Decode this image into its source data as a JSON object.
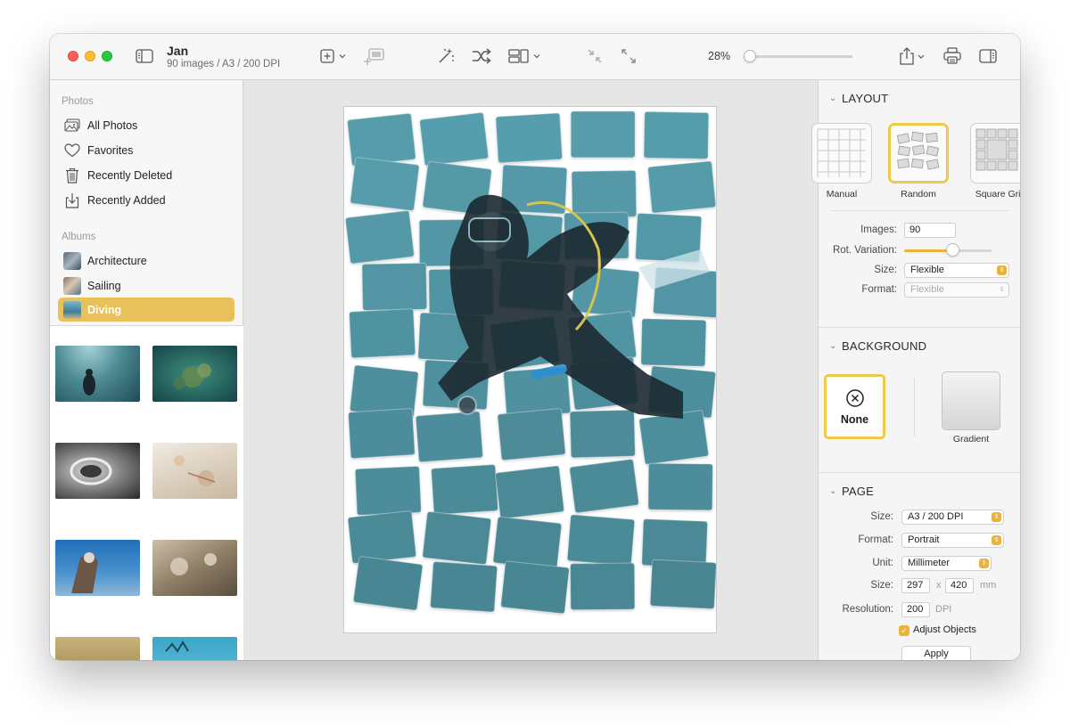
{
  "toolbar": {
    "title": "Jan",
    "subtitle": "90 images / A3 / 200 DPI",
    "zoom": "28%",
    "zoom_level": 0.0
  },
  "sidebar": {
    "photos_header": "Photos",
    "photos": [
      {
        "label": "All Photos",
        "icon": "photo-stack-icon"
      },
      {
        "label": "Favorites",
        "icon": "heart-icon"
      },
      {
        "label": "Recently Deleted",
        "icon": "trash-icon"
      },
      {
        "label": "Recently Added",
        "icon": "import-icon"
      }
    ],
    "albums_header": "Albums",
    "albums": [
      {
        "label": "Architecture",
        "active": false
      },
      {
        "label": "Sailing",
        "active": false
      },
      {
        "label": "Diving",
        "active": true
      }
    ]
  },
  "inspector": {
    "layout": {
      "header": "LAYOUT",
      "options": [
        {
          "label": "Manual",
          "selected": false
        },
        {
          "label": "Random",
          "selected": true
        },
        {
          "label": "Square Grid",
          "selected": false
        }
      ],
      "images_label": "Images:",
      "images_value": "90",
      "rotation_label": "Rot. Variation:",
      "rotation_value": 0.55,
      "size_label": "Size:",
      "size_value": "Flexible",
      "format_label": "Format:",
      "format_value": "Flexible"
    },
    "background": {
      "header": "BACKGROUND",
      "none_label": "None",
      "gradient_label": "Gradient"
    },
    "page": {
      "header": "PAGE",
      "size_label": "Size:",
      "size_value": "A3 / 200 DPI",
      "format_label": "Format:",
      "format_value": "Portrait",
      "unit_label": "Unit:",
      "unit_value": "Millimeter",
      "dims_label": "Size:",
      "width": "297",
      "x_sep": "x",
      "height": "420",
      "dims_unit": "mm",
      "resolution_label": "Resolution:",
      "resolution_value": "200",
      "resolution_unit": "DPI",
      "adjust_label": "Adjust Objects",
      "apply_label": "Apply"
    }
  },
  "colors": {
    "accent": "#e9c15a",
    "selection_border": "#f0c94a",
    "tile": "#7fbfcc"
  }
}
